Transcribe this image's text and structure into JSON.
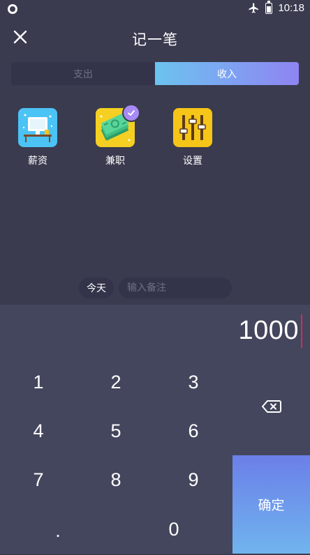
{
  "status_bar": {
    "time": "10:18"
  },
  "header": {
    "title": "记一笔"
  },
  "tabs": [
    {
      "label": "支出",
      "active": false
    },
    {
      "label": "收入",
      "active": true
    }
  ],
  "categories": [
    {
      "label": "薪资",
      "icon": "salary-icon",
      "color": "#4cc3f5",
      "selected": false
    },
    {
      "label": "兼职",
      "icon": "cash-icon",
      "color": "#f5d022",
      "selected": true
    },
    {
      "label": "设置",
      "icon": "settings-sliders-icon",
      "color": "#f5c518",
      "selected": false
    }
  ],
  "memo": {
    "today_label": "今天",
    "placeholder": "输入备注"
  },
  "keypad": {
    "amount": "1000",
    "keys": [
      "1",
      "2",
      "3",
      "4",
      "5",
      "6",
      "7",
      "8",
      "9",
      ".",
      "0"
    ],
    "confirm_label": "确定"
  },
  "colors": {
    "background": "#3a3b4f",
    "keypad_background": "#44465d",
    "accent_gradient_start": "#6cc3f0",
    "accent_gradient_end": "#8f84f2",
    "cursor": "#e0245e"
  }
}
